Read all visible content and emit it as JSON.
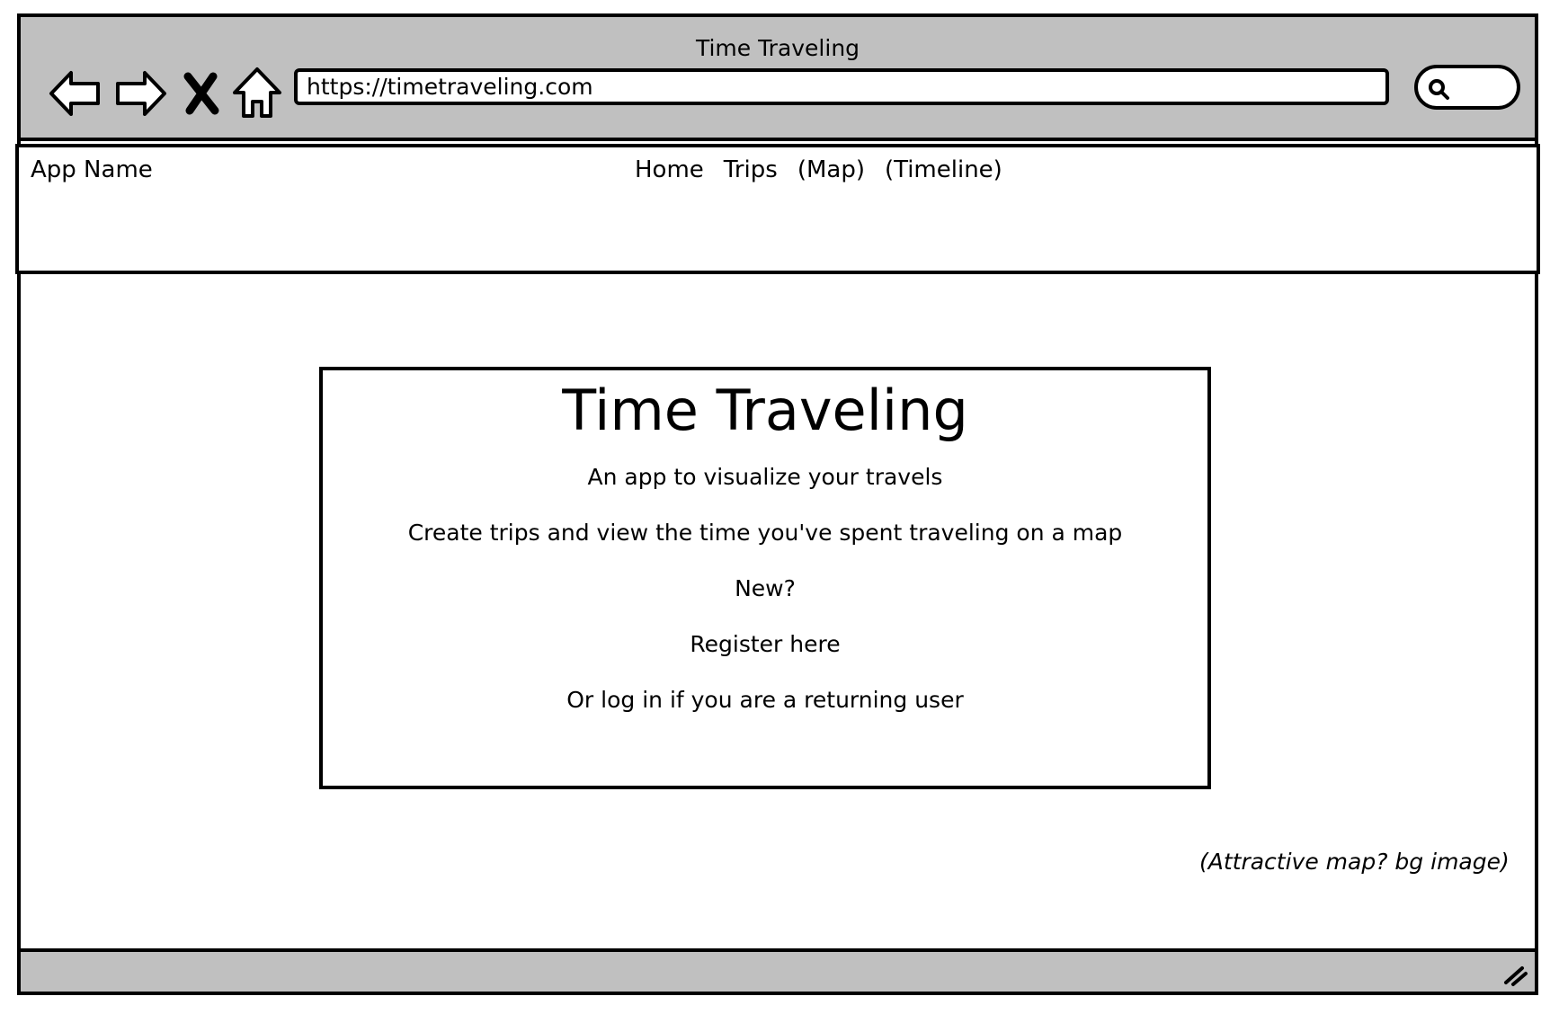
{
  "browser": {
    "window_title": "Time Traveling",
    "url": "https://timetraveling.com",
    "icons": {
      "back": "back-arrow-icon",
      "forward": "forward-arrow-icon",
      "stop": "close-icon",
      "home": "home-icon",
      "search": "search-icon",
      "resize": "resize-grip-icon"
    }
  },
  "header": {
    "app_name": "App Name",
    "nav": {
      "home": "Home",
      "trips": "Trips",
      "map": "(Map)",
      "timeline": "(Timeline)"
    }
  },
  "hero": {
    "title": "Time Traveling",
    "tagline": "An app to visualize your travels",
    "description": "Create trips and view the time you've spent traveling on a map",
    "new_prompt": "New?",
    "register_link": "Register here",
    "login_text": "Or log in if you are a returning user"
  },
  "notes": {
    "background": "(Attractive map? bg image)"
  },
  "colors": {
    "chrome": "#c0c0c0",
    "stroke": "#000000",
    "background": "#ffffff"
  }
}
